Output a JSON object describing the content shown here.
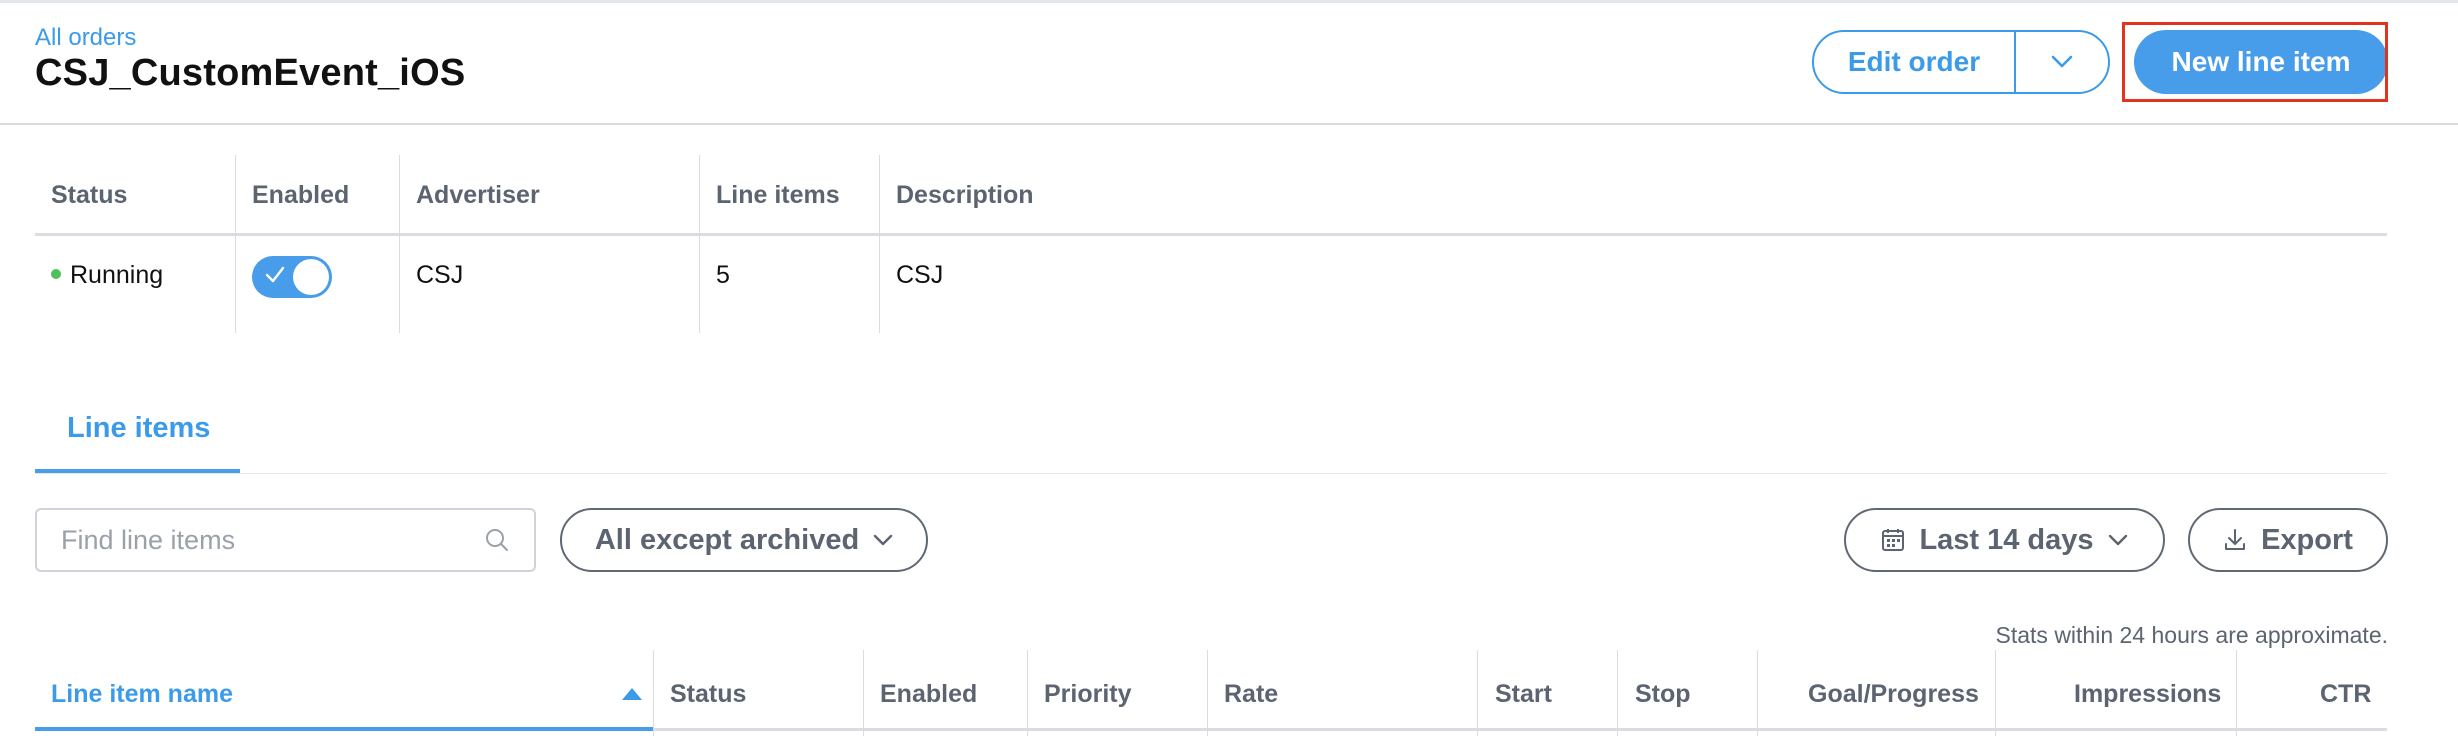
{
  "header": {
    "breadcrumb": "All orders",
    "title": "CSJ_CustomEvent_iOS",
    "edit_label": "Edit order",
    "primary_label": "New line item"
  },
  "summary": {
    "headers": [
      "Status",
      "Enabled",
      "Advertiser",
      "Line items",
      "Description"
    ],
    "row": {
      "status": "Running",
      "enabled": true,
      "advertiser": "CSJ",
      "line_items": "5",
      "description": "CSJ"
    }
  },
  "tabs": [
    {
      "label": "Line items",
      "active": true
    }
  ],
  "filters": {
    "search_placeholder": "Find line items",
    "search_value": "",
    "archived_label": "All except archived",
    "range_label": "Last 14 days",
    "export_label": "Export"
  },
  "note": "Stats within 24 hours are approximate.",
  "line_items_table": {
    "headers": [
      "Line item name",
      "Status",
      "Enabled",
      "Priority",
      "Rate",
      "Start",
      "Stop",
      "Goal/Progress",
      "Impressions",
      "CTR"
    ],
    "sorted_column": "Line item name",
    "sort_direction": "ascending"
  },
  "colors": {
    "accent": "#479de9",
    "link": "#3b9be8",
    "running": "#4cc25b",
    "highlight": "#e0341f"
  },
  "icons": [
    "chevron-down-icon",
    "check-icon",
    "search-icon",
    "calendar-icon",
    "download-icon",
    "sort-asc-icon"
  ]
}
